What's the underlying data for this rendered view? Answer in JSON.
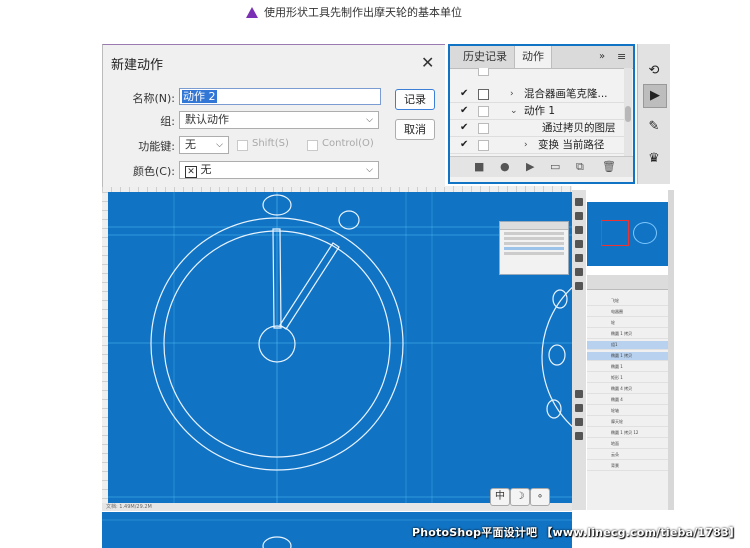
{
  "caption": {
    "text": "使用形状工具先制作出摩天轮的基本单位"
  },
  "dialog": {
    "title": "新建动作",
    "name_label": "名称(N):",
    "name_value": "动作 2",
    "group_label": "组:",
    "group_value": "默认动作",
    "fkey_label": "功能键:",
    "fkey_value": "无",
    "shift_label": "Shift(S)",
    "control_label": "Control(O)",
    "color_label": "颜色(C):",
    "color_value": "无",
    "record_button": "记录",
    "cancel_button": "取消"
  },
  "actions_panel": {
    "tabs": [
      "历史记录",
      "动作"
    ],
    "active_tab": "动作",
    "menu_glyph": "»",
    "rows": [
      {
        "text": "混合器画笔克隆...",
        "checked": true,
        "indent": 1
      },
      {
        "text": "动作 1",
        "checked": true,
        "indent": 1
      },
      {
        "text": "通过拷贝的图层",
        "checked": true,
        "indent": 2
      },
      {
        "text": "变换 当前路径",
        "checked": true,
        "indent": 2
      }
    ]
  },
  "canvas_buttons": [
    "中",
    "☽",
    "∘"
  ],
  "layers_panel": {
    "rows": [
      "飞轮",
      "电器圈",
      "轮",
      "椭圆 1 拷贝",
      "组1",
      "椭圆 1 拷贝",
      "椭圆 1",
      "矩形 1",
      "椭圆 4 拷贝",
      "椭圆 4",
      "轮轴",
      "摩天轮",
      "椭圆 1 拷贝 12",
      "地面",
      "云朵",
      "背景"
    ],
    "selected_rows": [
      4,
      5
    ]
  },
  "status_bar": {
    "text": "文档: 1.49M/29.2M"
  },
  "watermark": {
    "text": "PhotoShop平面设计吧 【www.linecg.com/tieba/1783】"
  },
  "colors": {
    "canvas_blue": "#1173c4",
    "caption_triangle": "#7b2fb5",
    "selection_blue": "#3377d6",
    "outline_white": "#e8f4ff"
  }
}
